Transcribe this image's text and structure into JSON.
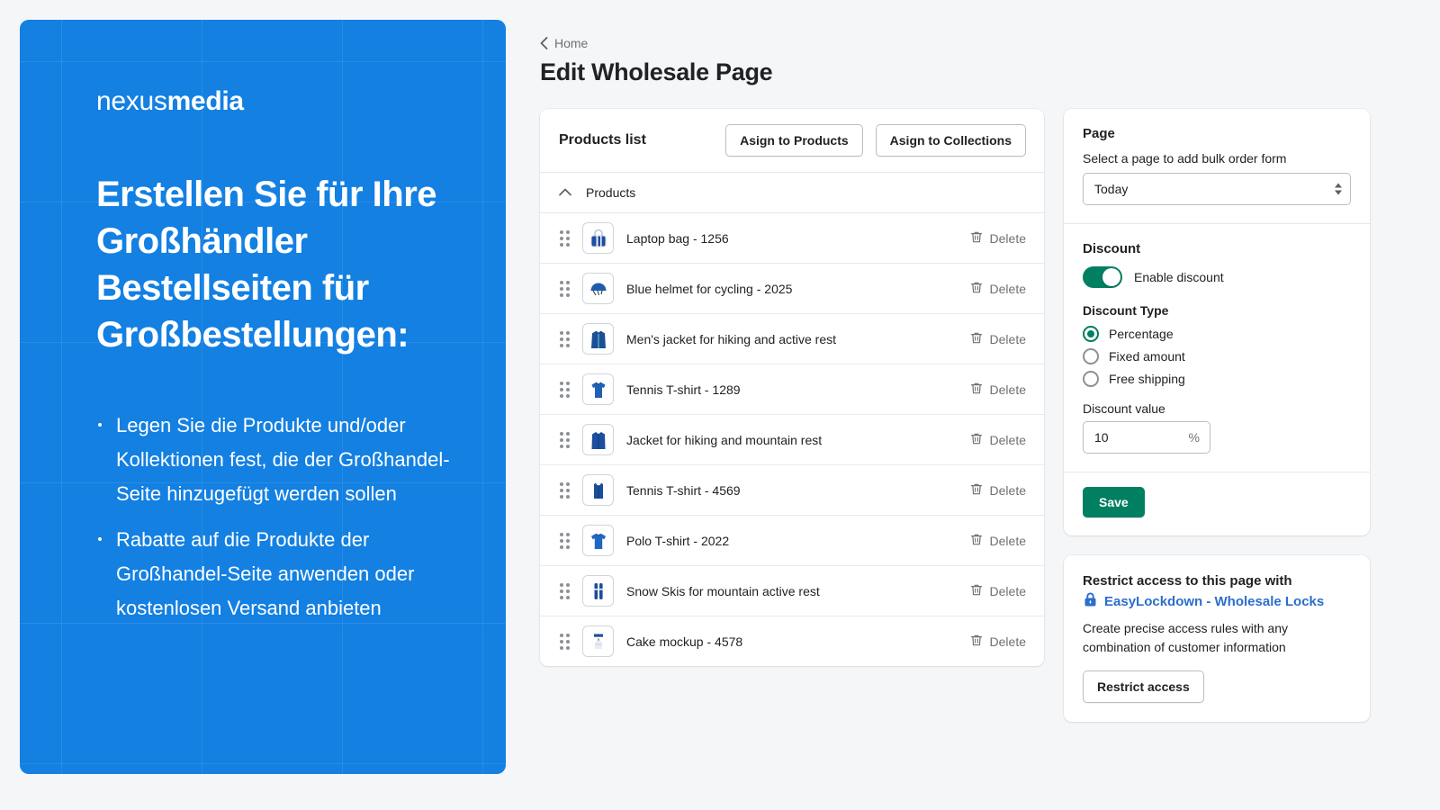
{
  "promo": {
    "logo_light": "nexus",
    "logo_bold": "media",
    "heading": "Erstellen Sie für Ihre Großhändler Bestellseiten für Großbestellungen:",
    "bullets": [
      "Legen Sie die Produkte und/oder Kollektionen fest, die der Großhandel-Seite hinzugefügt werden sollen",
      "Rabatte auf die Produkte der Großhandel-Seite anwenden oder kostenlosen Versand anbieten"
    ],
    "background_color": "#1380e2"
  },
  "header": {
    "breadcrumb": "Home",
    "title": "Edit Wholesale Page"
  },
  "products_card": {
    "title": "Products list",
    "assign_products_label": "Asign to Products",
    "assign_collections_label": "Asign to Collections",
    "group_label": "Products",
    "delete_label": "Delete",
    "rows": [
      {
        "name": "Laptop bag - 1256",
        "icon": "laptop-bag-thumbnail"
      },
      {
        "name": "Blue helmet for cycling - 2025",
        "icon": "helmet-thumbnail"
      },
      {
        "name": "Men's jacket for hiking and active rest",
        "icon": "jacket-thumbnail"
      },
      {
        "name": "Tennis T-shirt - 1289",
        "icon": "tshirt-thumbnail"
      },
      {
        "name": "Jacket for hiking and mountain rest",
        "icon": "jacket-thumbnail"
      },
      {
        "name": "Tennis T-shirt - 4569",
        "icon": "tanktop-thumbnail"
      },
      {
        "name": "Polo T-shirt - 2022",
        "icon": "polo-thumbnail"
      },
      {
        "name": "Snow Skis for mountain active rest",
        "icon": "skis-thumbnail"
      },
      {
        "name": "Cake mockup - 4578",
        "icon": "cake-thumbnail"
      }
    ]
  },
  "settings_card": {
    "page_section_title": "Page",
    "page_help": "Select a page to add bulk order form",
    "page_selected": "Today",
    "discount_section_title": "Discount",
    "enable_discount_label": "Enable discount",
    "enable_discount_on": true,
    "discount_type_title": "Discount Type",
    "discount_types": [
      {
        "label": "Percentage",
        "selected": true
      },
      {
        "label": "Fixed amount",
        "selected": false
      },
      {
        "label": "Free shipping",
        "selected": false
      }
    ],
    "discount_value_label": "Discount value",
    "discount_value": "10",
    "discount_value_suffix": "%",
    "save_label": "Save",
    "accent_color": "#008060"
  },
  "restrict_card": {
    "title": "Restrict access to this page with",
    "link_label": "EasyLockdown - Wholesale Locks",
    "description": "Create precise access rules with any combination of customer information",
    "button_label": "Restrict access",
    "link_color": "#2c6ecb"
  }
}
